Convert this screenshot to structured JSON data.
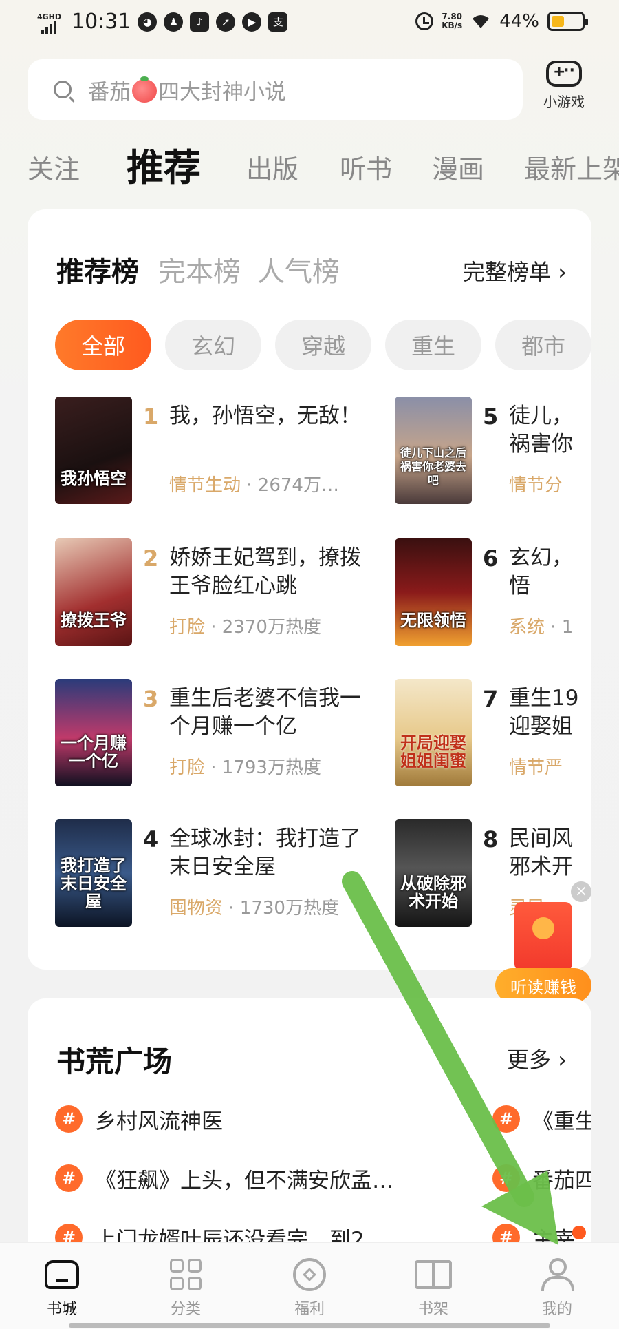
{
  "status_bar": {
    "network": "4GHD",
    "time": "10:31",
    "speed_value": "7.80",
    "speed_unit": "KB/s",
    "battery_percent": "44%",
    "battery_level": 0.44,
    "battery_color": "#f7b71a",
    "app_icons": [
      "wechat-icon",
      "qq-icon",
      "tiktok-icon",
      "compass-icon",
      "play-icon",
      "alipay-icon"
    ]
  },
  "search": {
    "placeholder_pre": "番茄",
    "placeholder_post": "四大封神小说"
  },
  "mini_game": {
    "label": "小游戏"
  },
  "top_tabs": [
    "关注",
    "推荐",
    "出版",
    "听书",
    "漫画",
    "最新上架"
  ],
  "ranking": {
    "tabs": [
      "推荐榜",
      "完本榜",
      "人气榜"
    ],
    "full_list": "完整榜单 ›",
    "chips": [
      "全部",
      "玄幻",
      "穿越",
      "重生",
      "都市"
    ],
    "books": [
      {
        "rank": "1",
        "title": "我，孙悟空，无敌！",
        "tag": "情节生动",
        "meta": " · 2674万…",
        "cover_text": "我孙悟空"
      },
      {
        "rank": "2",
        "title": "娇娇王妃驾到，撩拨王爷脸红心跳",
        "tag": "打脸",
        "meta": " · 2370万热度",
        "cover_text": "撩拨王爷"
      },
      {
        "rank": "3",
        "title": "重生后老婆不信我一个月赚一个亿",
        "tag": "打脸",
        "meta": " · 1793万热度",
        "cover_text": "一个月赚一个亿"
      },
      {
        "rank": "4",
        "title": "全球冰封：我打造了末日安全屋",
        "tag": "囤物资",
        "meta": " · 1730万热度",
        "cover_text": "我打造了末日安全屋"
      },
      {
        "rank": "5",
        "title": "徒儿，祸害你",
        "tag": "情节分",
        "meta": "",
        "cover_text": "徒儿下山之后祸害你老婆去吧"
      },
      {
        "rank": "6",
        "title": "玄幻，悟",
        "tag": "系统",
        "meta": " · 1",
        "cover_text": "无限领悟"
      },
      {
        "rank": "7",
        "title": "重生19迎娶姐",
        "tag": "情节严",
        "meta": "",
        "cover_text": "开局迎娶姐姐闺蜜"
      },
      {
        "rank": "8",
        "title": "民间风邪术开",
        "tag": "灵异",
        "meta": "",
        "cover_text": "从破除邪术开始"
      }
    ]
  },
  "float": {
    "close": "×",
    "label": "听读赚钱"
  },
  "plaza": {
    "title": "书荒广场",
    "more": "更多 ›",
    "topics": [
      "乡村风流神医",
      "《狂飙》上头，但不满安欣孟…",
      "上门龙婿叶辰还没看完，到2…",
      "《重生",
      "番茄四",
      "主宰"
    ]
  },
  "bottom_nav": [
    "书城",
    "分类",
    "福利",
    "书架",
    "我的"
  ]
}
